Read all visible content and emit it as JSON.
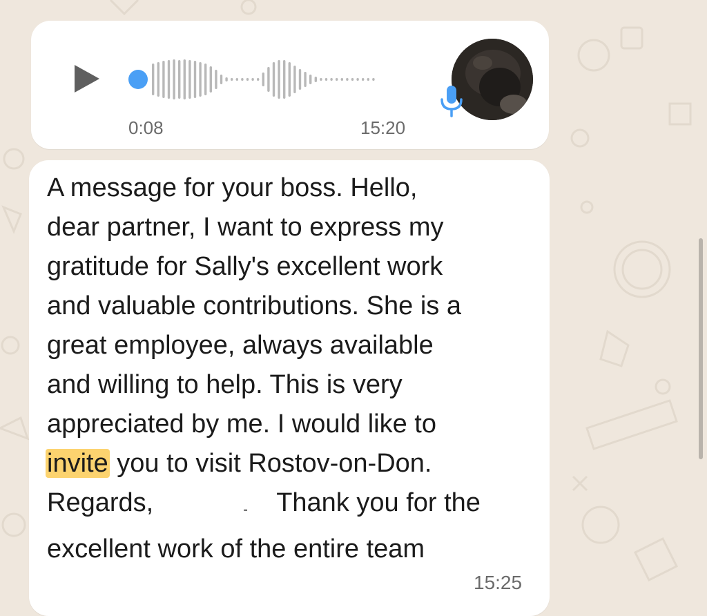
{
  "voice_message": {
    "duration": "0:08",
    "time": "15:20",
    "progress": 0.0,
    "accent_color": "#4a9ff5"
  },
  "text_message": {
    "lines": [
      "A message for your boss. Hello,",
      "dear partner, I want to express my",
      "gratitude for Sally's excellent work",
      "and valuable contributions. She is a",
      "great employee, always available",
      "and willing to help. This is very",
      "appreciated by me. I would like to"
    ],
    "line8_highlight": "invite",
    "line8_rest": " you to visit Rostov-on-Don.",
    "line9_start": "Regards,",
    "line9_mark": "-",
    "line9_end": "Thank you for the",
    "line10": "excellent work of the entire team",
    "time": "15:25",
    "highlight_color": "#fcd36f"
  },
  "icons": {
    "play": "play-icon",
    "mic": "microphone-icon",
    "avatar": "avatar"
  }
}
